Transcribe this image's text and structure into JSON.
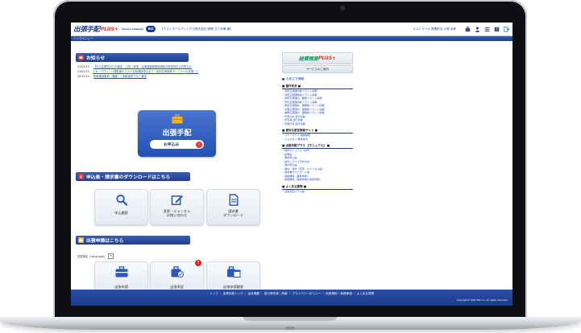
{
  "header": {
    "logo_text": "出張手配",
    "logo_plus": "PLUS+",
    "logo_sub": "Service Company",
    "logo_badge": "BIZ",
    "company": "【テストホールディングス株式会社 総務 きさみ様 様】",
    "user": "エルトラベル 営業担当 小林 太郎",
    "icons": [
      "bag-icon",
      "person-icon",
      "list-icon",
      "help-icon",
      "logout-icon"
    ]
  },
  "nav": {
    "breadcrumb": "トップメニュー"
  },
  "news": {
    "title": "お知らせ",
    "items": [
      {
        "date": "21/02/15",
        "text": "【中小企業向け】JR東北・山形・秋田・北海道新幹線利用時の特別割引のお知らせ"
      },
      {
        "date": "21/01/15",
        "text": "スカーラウィーバ運航便のスカイ利用運航停止まで（羽田空港発着ターミナルの変更）に注意"
      },
      {
        "date": "20/12/24",
        "text": "新幹線回数券（乗継）一部取扱終了のご案内"
      }
    ]
  },
  "hero": {
    "title": "出張手配",
    "button_label": "お申込み"
  },
  "downloads": {
    "title": "申込後・請求書のダウンロードはこちら",
    "tiles": [
      {
        "label": "申込履歴"
      },
      {
        "label": "変更・キャンセル\nお問い合わせ"
      },
      {
        "label": "請求書\nダウンロード"
      }
    ]
  },
  "approval": {
    "title": "出張申請はこちら",
    "language_label": "言語設定（Language）",
    "tiles": [
      {
        "label": "出張申請"
      },
      {
        "label": "出張承認",
        "badge": "!"
      },
      {
        "label": "出張申請履歴"
      }
    ]
  },
  "right_panel": {
    "logo_text": "経費精算",
    "logo_plus": "PLUS+",
    "service_label": "サービスのご案内",
    "heading": "お役立ち情報",
    "groups": [
      {
        "title": "■ 運行状況 ■",
        "links": [
          "・羽田空港国内線フライト情報",
          "・羽田空港国際線フライト情報",
          "・成田空港国内、国際フライト情報",
          "・伊丹空港国内線フライト情報",
          "・関西空港国内、国際線フライト情報",
          "・中部空港国内、国際線フライト情報",
          "・福岡空港国内、国際線フライト情報",
          "・JR東日本 運行情報",
          "・JR東海 運行情報",
          "・JR西日本 運行情報"
        ]
      },
      {
        "title": "■ 便利な航空検索サイト ■",
        "links": [
          "・ＳＫＹＲＯ１ 路線検索",
          "・ジョルダン 乗換案内"
        ]
      },
      {
        "title": "■ 出張手配プラス 【マニュアル】 ■",
        "links": [
          "・操作マニュアル（pdf）",
          "・新規編",
          "・国内申込編",
          "・楽天トラベル予約方法",
          "・海外申込編",
          "・国内、海外（変更・キャンセル編）",
          "・請求書ダウンロード編",
          "・承認機能（事前申請）",
          "・承認機能（事前申請＆承認判断）"
        ]
      },
      {
        "title": "■ よくある質問 ■",
        "links": [
          "・出張手配プラス編"
        ]
      }
    ]
  },
  "footer": {
    "links": "トップ ｜ 出張手配トップ ｜ 会社概要 ｜ 旅行条件書・約款 ｜ プライバシーポリシー ｜ 利用規約・免責事項 ｜ よくある質問",
    "copyright": "Copyright© 2021 ELT Inc. All rights reserved."
  },
  "colors": {
    "brand_blue": "#1e3f91",
    "accent_red": "#e23a2e",
    "green": "#19a05a"
  }
}
